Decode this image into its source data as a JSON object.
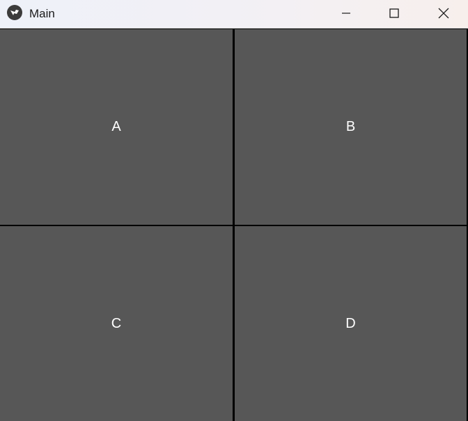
{
  "window": {
    "title": "Main",
    "app_icon": "kivy-logo-icon",
    "controls": {
      "minimize": "minimize-icon",
      "maximize": "maximize-icon",
      "close": "close-icon"
    }
  },
  "buttons": {
    "a": "A",
    "b": "B",
    "c": "C",
    "d": "D"
  },
  "colors": {
    "button_bg": "#575757",
    "grid_separator": "#000000",
    "button_text": "#ffffff"
  }
}
